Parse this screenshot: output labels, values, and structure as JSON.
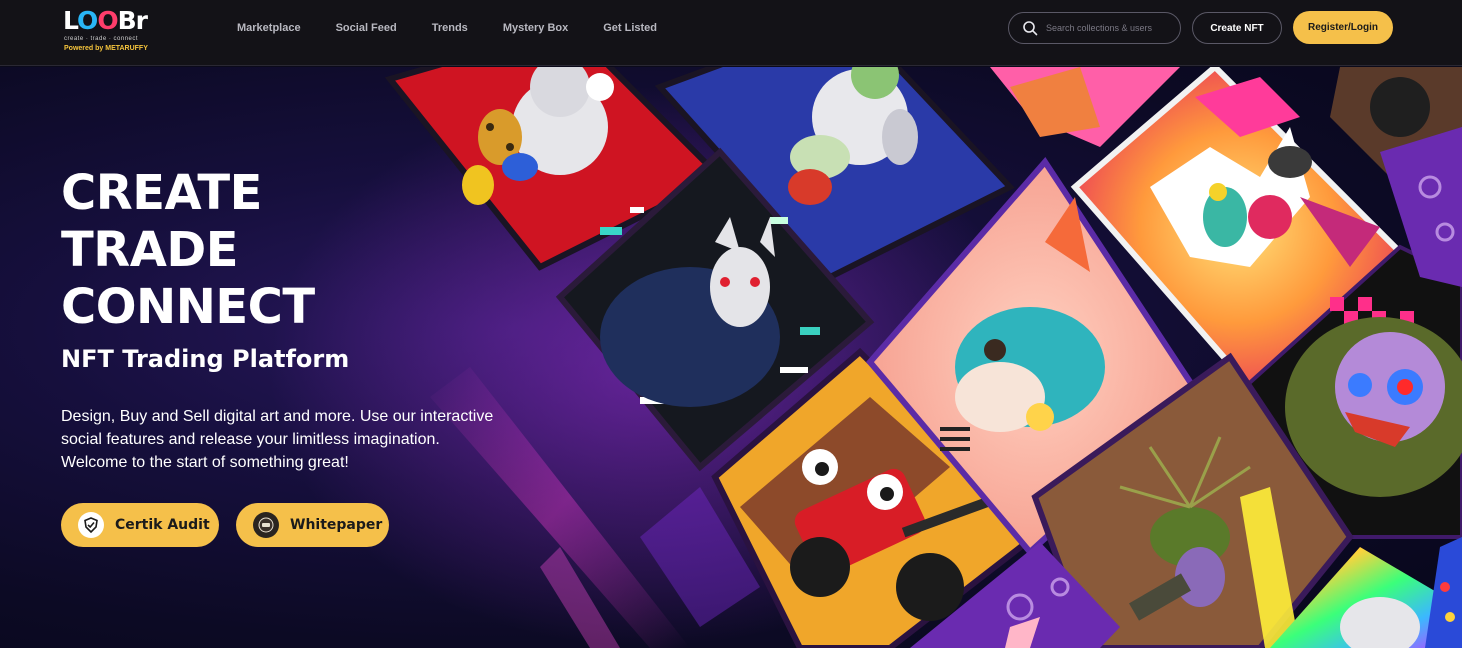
{
  "header": {
    "logo": {
      "wordmark": "LOOBr",
      "tagline": "create · trade · connect",
      "powered": "Powered by METARUFFY"
    },
    "nav": [
      {
        "label": "Marketplace"
      },
      {
        "label": "Social Feed"
      },
      {
        "label": "Trends"
      },
      {
        "label": "Mystery Box"
      },
      {
        "label": "Get Listed"
      }
    ],
    "search": {
      "placeholder": "Search collections & users",
      "value": ""
    },
    "create_nft_label": "Create NFT",
    "register_label": "Register/Login"
  },
  "hero": {
    "title_lines": [
      "CREATE",
      "TRADE",
      "CONNECT"
    ],
    "subtitle": "NFT Trading Platform",
    "description_lines": [
      "Design, Buy and Sell digital art and more. Use our interactive",
      "social features and release your limitless imagination.",
      "Welcome to the start of something great!"
    ],
    "buttons": [
      {
        "label": "Certik Audit",
        "icon": "certik-shield-icon"
      },
      {
        "label": "Whitepaper",
        "icon": "whitepaper-logo-icon"
      }
    ]
  },
  "colors": {
    "accent": "#f5c04a",
    "topbar_bg": "#131217",
    "hero_bg": "#160f3d",
    "text": "#ffffff"
  }
}
